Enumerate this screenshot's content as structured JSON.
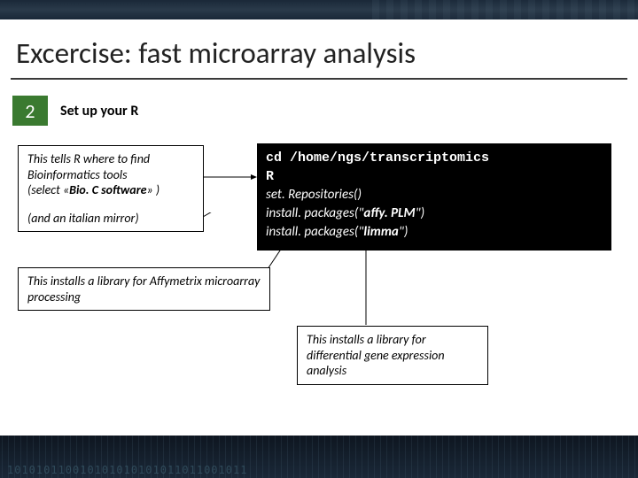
{
  "title": "Excercise: fast microarray analysis",
  "step": {
    "number": "2",
    "label": "Set up your R"
  },
  "notes": {
    "bioc": {
      "line1": "This tells R where to find",
      "line2": "Bioinformatics tools",
      "line3_pre": "(select «",
      "line3_bold": "Bio. C software",
      "line3_post": "» )",
      "extra": "(and an italian mirror)"
    },
    "affy": "This installs a library for Affymetrix microarray processing",
    "limma": "This installs a library for differential gene expression analysis"
  },
  "code": {
    "l1": "cd /home/ngs/transcriptomics",
    "l2": "R",
    "l3": "set. Repositories()",
    "l4_pre": "install. packages(\"",
    "l4_arg": "affy. PLM",
    "l4_post": "\")",
    "l5_pre": "install. packages(\"",
    "l5_arg": "limma",
    "l5_post": "\")"
  },
  "footer_bits": "101010110010101010101011011001011"
}
